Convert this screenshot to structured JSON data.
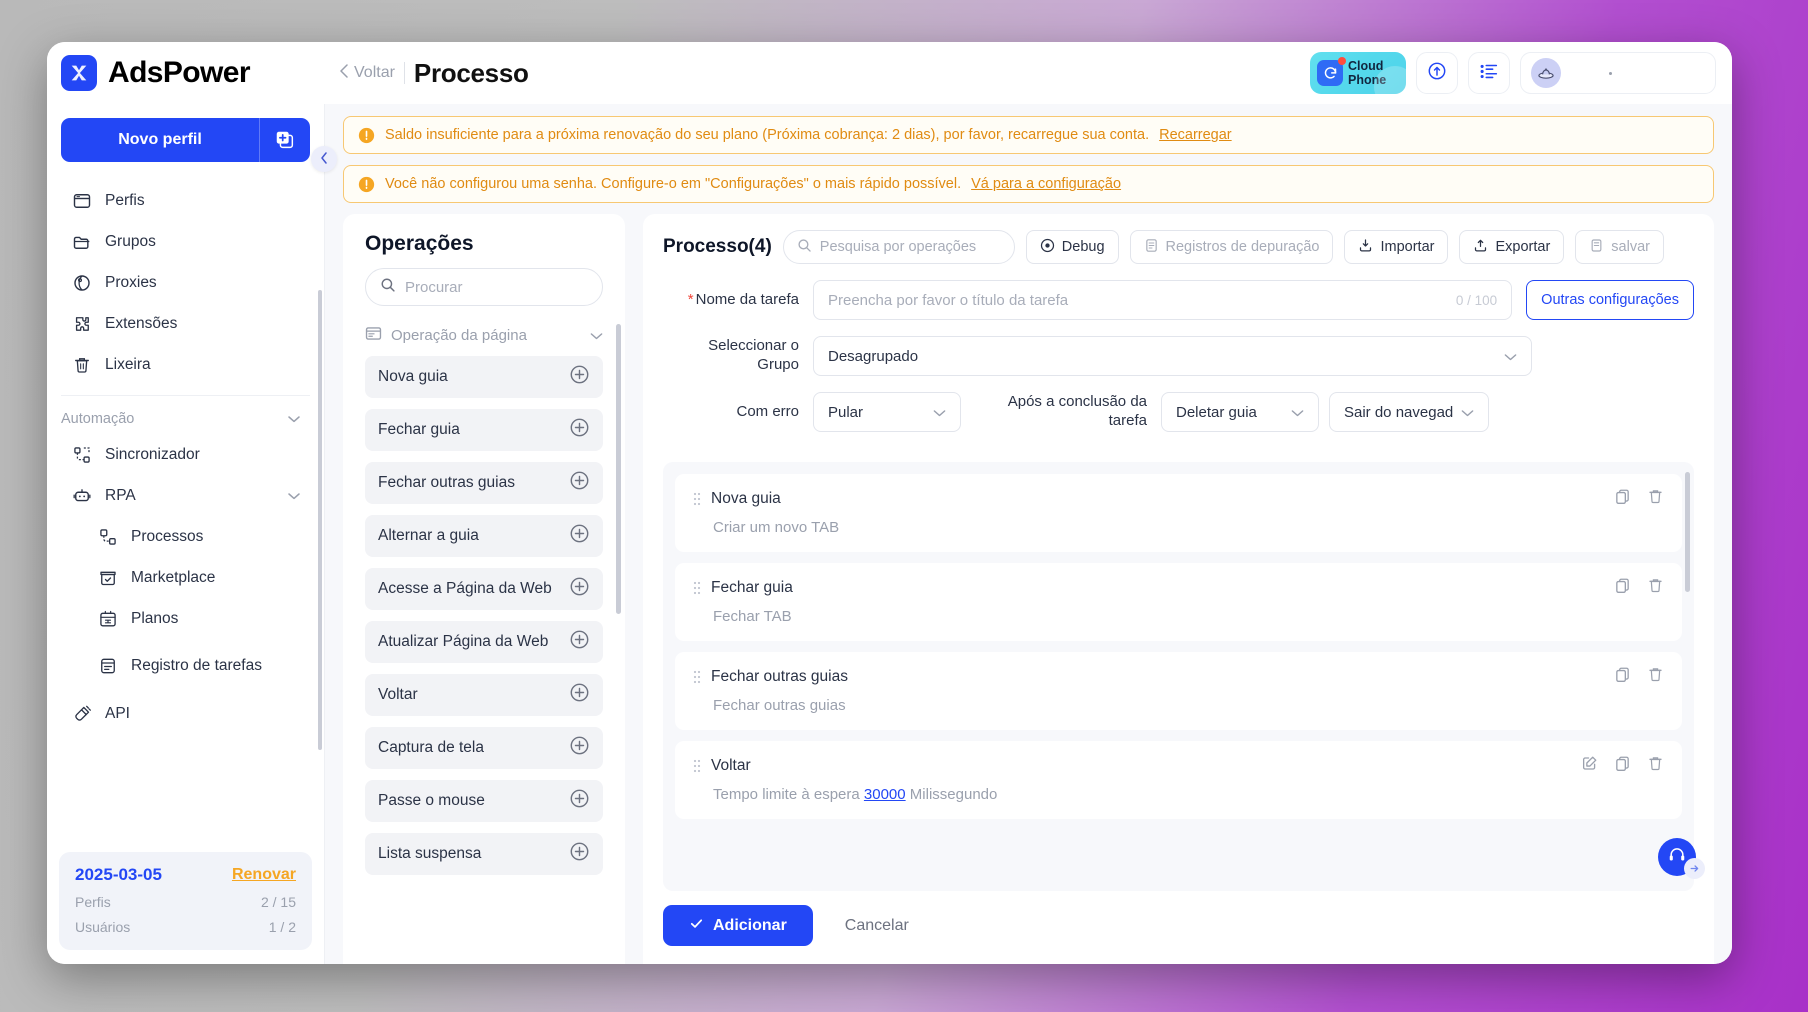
{
  "brand": {
    "name": "AdsPower",
    "logo_icon": "adspower-logo-icon"
  },
  "header": {
    "back_label": "Voltar",
    "title": "Processo",
    "cloud_phone": {
      "line1": "Cloud",
      "line2": "Phone"
    },
    "sync_icon": "sync-upload-icon",
    "list_icon": "task-list-icon",
    "avatar_icon": "ufo-avatar-icon"
  },
  "sidebar": {
    "new_profile_label": "Novo perfil",
    "new_profile_add_icon": "add-profile-icon",
    "collapse_icon": "chevron-left-icon",
    "items": [
      {
        "label": "Perfis",
        "icon": "browser-window-icon"
      },
      {
        "label": "Grupos",
        "icon": "folder-icon"
      },
      {
        "label": "Proxies",
        "icon": "globe-pin-icon"
      },
      {
        "label": "Extensões",
        "icon": "puzzle-icon"
      },
      {
        "label": "Lixeira",
        "icon": "trash-icon"
      }
    ],
    "group_label": "Automação",
    "group_chevron_icon": "chevron-down-icon",
    "automation_items": [
      {
        "label": "Sincronizador",
        "icon": "sync-nodes-icon",
        "sub": false,
        "chevron": false
      },
      {
        "label": "RPA",
        "icon": "robot-icon",
        "sub": false,
        "chevron": true
      },
      {
        "label": "Processos",
        "icon": "flow-nodes-icon",
        "sub": true,
        "chevron": false
      },
      {
        "label": "Marketplace",
        "icon": "marketplace-icon",
        "sub": true,
        "chevron": false
      },
      {
        "label": "Planos",
        "icon": "calendar-icon",
        "sub": true,
        "chevron": false
      },
      {
        "label": "Registro de tarefas",
        "icon": "task-record-icon",
        "sub": true,
        "chevron": false
      },
      {
        "label": "API",
        "icon": "plug-icon",
        "sub": false,
        "chevron": false
      }
    ],
    "license": {
      "date": "2025-03-05",
      "renew_label": "Renovar",
      "rows": [
        {
          "label": "Perfis",
          "value": "2 / 15"
        },
        {
          "label": "Usuários",
          "value": "1 / 2"
        }
      ]
    }
  },
  "alerts": [
    {
      "icon": "warning-icon",
      "text": "Saldo insuficiente para a próxima renovação do seu plano (Próxima cobrança: 2 dias), por favor, recarregue sua conta.",
      "link": "Recarregar"
    },
    {
      "icon": "warning-icon",
      "text": "Você não configurou uma senha. Configure-o em \"Configurações\" o mais rápido possível.",
      "link": "Vá para a configuração"
    }
  ],
  "operations": {
    "title": "Operações",
    "search_placeholder": "Procurar",
    "search_icon": "search-icon",
    "category": {
      "label": "Operação da página",
      "icon": "page-icon",
      "chevron_icon": "chevron-down-icon"
    },
    "items": [
      {
        "label": "Nova guia",
        "add_icon": "plus-circle-icon"
      },
      {
        "label": "Fechar guia",
        "add_icon": "plus-circle-icon"
      },
      {
        "label": "Fechar outras guias",
        "add_icon": "plus-circle-icon"
      },
      {
        "label": "Alternar a guia",
        "add_icon": "plus-circle-icon"
      },
      {
        "label": "Acesse a Página da Web",
        "add_icon": "plus-circle-icon"
      },
      {
        "label": "Atualizar Página da Web",
        "add_icon": "plus-circle-icon"
      },
      {
        "label": "Voltar",
        "add_icon": "plus-circle-icon"
      },
      {
        "label": "Captura de tela",
        "add_icon": "plus-circle-icon"
      },
      {
        "label": "Passe o mouse",
        "add_icon": "plus-circle-icon"
      },
      {
        "label": "Lista suspensa",
        "add_icon": "plus-circle-icon"
      }
    ]
  },
  "process": {
    "title": "Processo(4)",
    "search_placeholder": "Pesquisa por operações",
    "search_icon": "search-icon",
    "toolbar": [
      {
        "label": "Debug",
        "icon": "play-circle-icon",
        "muted": false
      },
      {
        "label": "Registros de depuração",
        "icon": "log-icon",
        "muted": true
      },
      {
        "label": "Importar",
        "icon": "import-icon",
        "muted": false
      },
      {
        "label": "Exportar",
        "icon": "export-icon",
        "muted": false
      },
      {
        "label": "salvar",
        "icon": "save-icon",
        "muted": true
      }
    ],
    "form": {
      "task_name_label": "Nome da tarefa",
      "task_name_required": "*",
      "task_name_placeholder": "Preencha por favor o título da tarefa",
      "task_name_value": "",
      "task_name_counter": "0 / 100",
      "other_settings_label": "Outras configurações",
      "group_label": "Seleccionar o Grupo",
      "group_value": "Desagrupado",
      "error_label": "Com erro",
      "error_value": "Pular",
      "after_label": "Após a conclusão da tarefa",
      "after_value_1": "Deletar guia",
      "after_value_2": "Sair do navegad",
      "chevron_icon": "chevron-down-icon"
    },
    "steps": [
      {
        "name": "Nova guia",
        "description": "Criar um novo TAB",
        "grip_icon": "drag-handle-icon",
        "actions": [
          "copy-icon",
          "trash-icon"
        ]
      },
      {
        "name": "Fechar guia",
        "description": "Fechar TAB",
        "grip_icon": "drag-handle-icon",
        "actions": [
          "copy-icon",
          "trash-icon"
        ]
      },
      {
        "name": "Fechar outras guias",
        "description": "Fechar outras guias",
        "grip_icon": "drag-handle-icon",
        "actions": [
          "copy-icon",
          "trash-icon"
        ]
      },
      {
        "name": "Voltar",
        "description_prefix": "Tempo limite à espera",
        "description_value": "30000",
        "description_suffix": "Milissegundo",
        "grip_icon": "drag-handle-icon",
        "actions": [
          "edit-icon",
          "copy-icon",
          "trash-icon"
        ]
      }
    ],
    "footer": {
      "submit_label": "Adicionar",
      "submit_icon": "check-icon",
      "cancel_label": "Cancelar"
    },
    "support_fab_icon": "headset-icon"
  },
  "colors": {
    "accent": "#2347f5",
    "warning": "#e08b12",
    "warning_border": "#f7c873",
    "renew": "#f5a623",
    "muted": "#9aa0ad",
    "panel_bg": "#f7f8fb"
  }
}
